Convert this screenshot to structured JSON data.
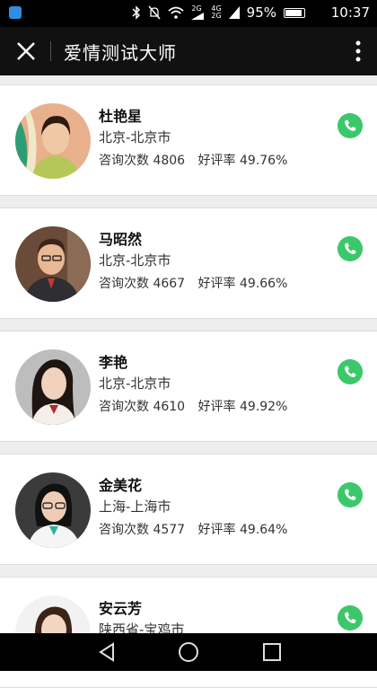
{
  "status_bar": {
    "network_top": "2G",
    "network_4g": "4G",
    "network_2g": "2G",
    "battery_text": "95%",
    "battery_level": 0.95,
    "time": "10:37"
  },
  "header": {
    "title": "爱情测试大师"
  },
  "counselors": [
    {
      "name": "杜艳星",
      "location": "北京-北京市",
      "consult_label": "咨询次数",
      "consult_count": "4806",
      "rating_label": "好评率",
      "rating": "49.76%"
    },
    {
      "name": "马昭然",
      "location": "北京-北京市",
      "consult_label": "咨询次数",
      "consult_count": "4667",
      "rating_label": "好评率",
      "rating": "49.66%"
    },
    {
      "name": "李艳",
      "location": "北京-北京市",
      "consult_label": "咨询次数",
      "consult_count": "4610",
      "rating_label": "好评率",
      "rating": "49.92%"
    },
    {
      "name": "金美花",
      "location": "上海-上海市",
      "consult_label": "咨询次数",
      "consult_count": "4577",
      "rating_label": "好评率",
      "rating": "49.64%"
    },
    {
      "name": "安云芳",
      "location": "陕西省-宝鸡市"
    }
  ],
  "colors": {
    "call_green": "#3cc86a",
    "header_bg": "#111111"
  }
}
